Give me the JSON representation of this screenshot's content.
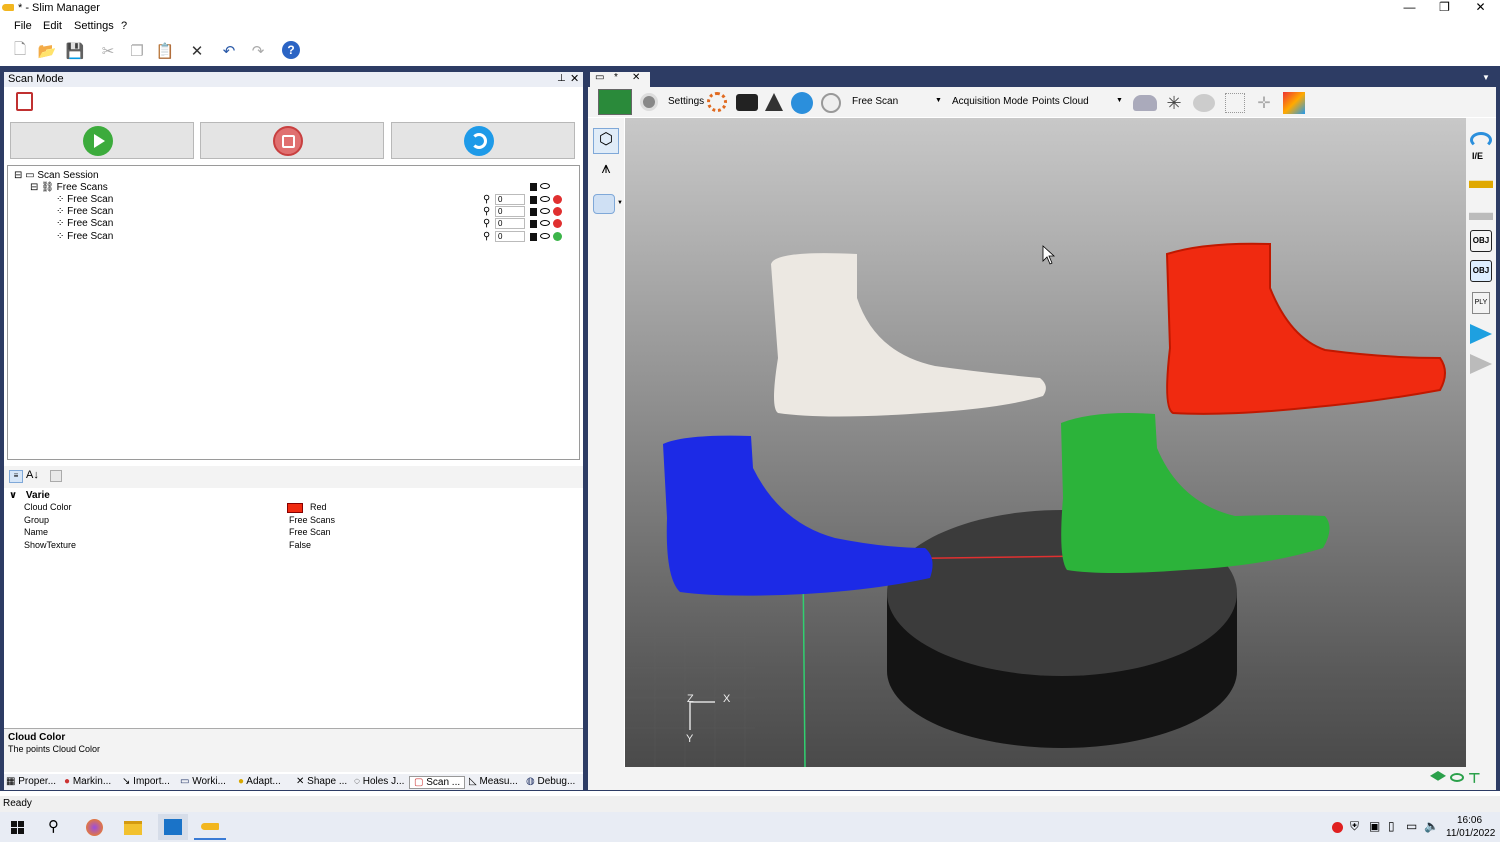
{
  "window": {
    "title": "* - Slim Manager",
    "controls": [
      "—",
      "❐",
      "✕"
    ]
  },
  "menu": [
    "File",
    "Edit",
    "Settings",
    "?"
  ],
  "scan_panel": {
    "title": "Scan Mode",
    "tree": {
      "root": "Scan Session",
      "group": "Free Scans",
      "items": [
        {
          "label": "Free Scan",
          "value": "0",
          "color": "#e03030"
        },
        {
          "label": "Free Scan",
          "value": "0",
          "color": "#e03030"
        },
        {
          "label": "Free Scan",
          "value": "0",
          "color": "#e03030"
        },
        {
          "label": "Free Scan",
          "value": "0",
          "color": "#3cb54a"
        }
      ]
    }
  },
  "properties": {
    "category": "Varie",
    "rows": [
      {
        "key": "Cloud Color",
        "value": "Red"
      },
      {
        "key": "Group",
        "value": "Free Scans"
      },
      {
        "key": "Name",
        "value": "Free Scan"
      },
      {
        "key": "ShowTexture",
        "value": "False"
      }
    ],
    "desc_title": "Cloud Color",
    "desc_text": "The points Cloud Color"
  },
  "left_tabs": [
    "Proper...",
    "Markin...",
    "Import...",
    "Worki...",
    "Adapt...",
    "Shape ...",
    "Holes J...",
    "Scan ...",
    "Measu...",
    "Debug..."
  ],
  "viewport_toolbar": {
    "settings_label": "Settings",
    "scan_select": "Free Scan",
    "acq_label": "Acquisition Mode",
    "acq_select": "Points Cloud"
  },
  "axis": {
    "x": "X",
    "y": "Y",
    "z": "Z"
  },
  "status": "Ready",
  "clock": {
    "time": "16:06",
    "date": "11/01/2022"
  },
  "colors": {
    "frame": "#2d3c64",
    "white_foot": "#ece8e2",
    "red_foot": "#f02a10",
    "blue_foot": "#1c2ae6",
    "green_foot": "#2cb33a"
  }
}
